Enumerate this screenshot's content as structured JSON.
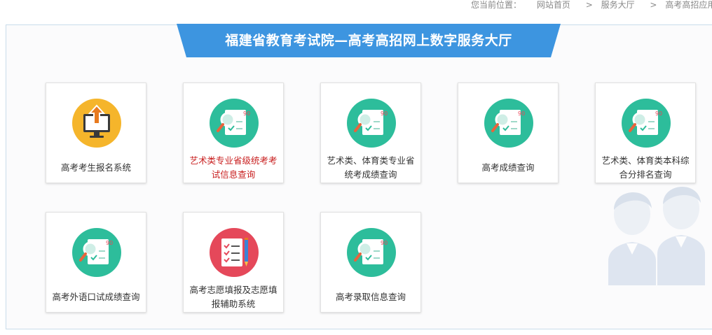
{
  "breadcrumb": {
    "prefix": "您当前位置：",
    "items": [
      "网站首页",
      "服务大厅",
      "高考高招应用"
    ],
    "separator": ">"
  },
  "banner": {
    "title": "福建省教育考试院—高考高招网上数字服务大厅",
    "color": "#3d95e0"
  },
  "tiles": [
    {
      "label": "高考考生报名系统",
      "icon": "computer-upload-icon",
      "color": "#f5b52b"
    },
    {
      "label": "艺术类专业省级统考考试信息查询",
      "icon": "score-search-icon",
      "color": "#2dbd9b",
      "highlight": true
    },
    {
      "label": "艺术类、体育类专业省统考成绩查询",
      "icon": "score-search-icon",
      "color": "#2dbd9b"
    },
    {
      "label": "高考成绩查询",
      "icon": "score-search-icon",
      "color": "#2dbd9b"
    },
    {
      "label": "艺术类、体育类本科综合分排名查询",
      "icon": "score-search-icon",
      "color": "#2dbd9b"
    },
    {
      "label": "高考外语口试成绩查询",
      "icon": "score-search-icon",
      "color": "#2dbd9b"
    },
    {
      "label": "高考志愿填报及志愿填报辅助系统",
      "icon": "form-pencil-icon",
      "color": "#e5485a"
    },
    {
      "label": "高考录取信息查询",
      "icon": "score-search-icon",
      "color": "#2dbd9b"
    }
  ],
  "score_badge": "90"
}
